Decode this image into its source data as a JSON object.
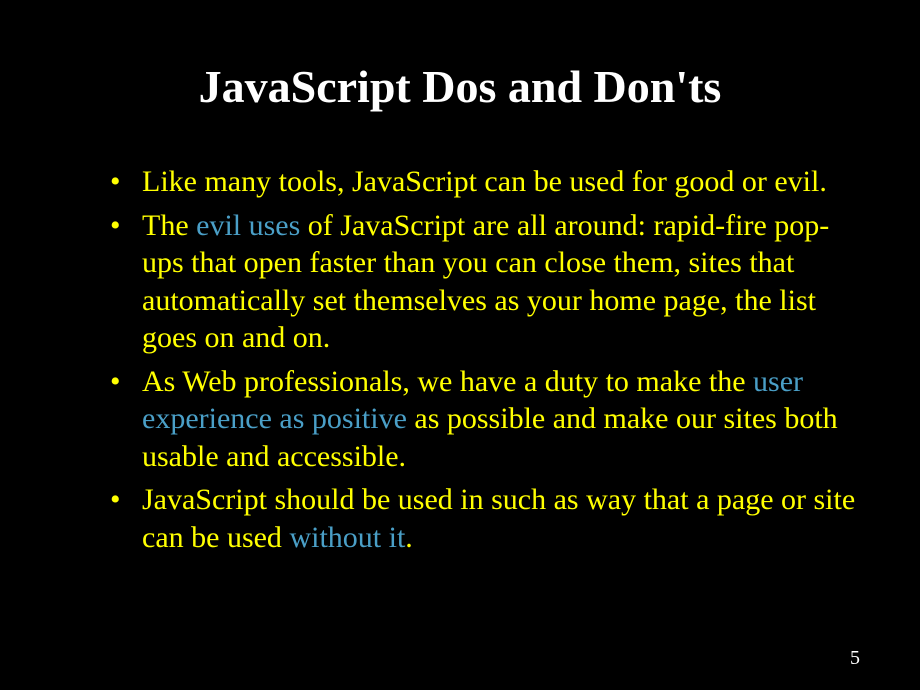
{
  "slide": {
    "title": "JavaScript Dos and Don'ts",
    "bullets": [
      {
        "pre": "Like many tools, JavaScript can be used for good or evil.",
        "highlight": "",
        "post": ""
      },
      {
        "pre": "The ",
        "highlight": "evil uses",
        "post": " of JavaScript are all around: rapid-fire pop-ups that open faster than you can close them, sites that automatically set themselves as your home page, the list goes on and on."
      },
      {
        "pre": "As Web professionals, we have a duty to make the ",
        "highlight": "user experience as positive",
        "post": " as possible and make our sites both usable and accessible."
      },
      {
        "pre": "JavaScript should be used in such as way that a page or site can be used ",
        "highlight": "without it",
        "post": "."
      }
    ],
    "page_number": "5"
  }
}
